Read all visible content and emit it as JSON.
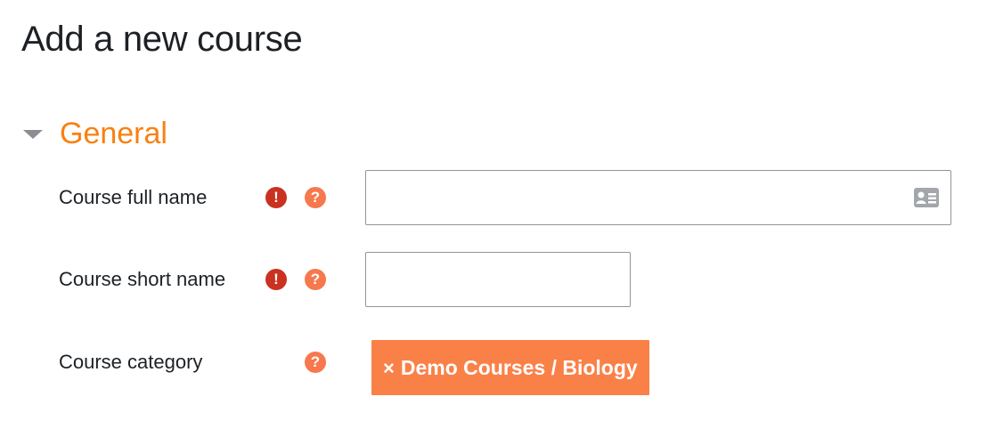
{
  "page": {
    "title": "Add a new course"
  },
  "section": {
    "title": "General",
    "expanded": true
  },
  "fields": [
    {
      "label": "Course full name",
      "required": true,
      "required_glyph": "!",
      "help_glyph": "?",
      "value": "",
      "icon": "contact-card-icon"
    },
    {
      "label": "Course short name",
      "required": true,
      "required_glyph": "!",
      "help_glyph": "?",
      "value": ""
    },
    {
      "label": "Course category",
      "required": false,
      "help_glyph": "?",
      "selected": {
        "remove_glyph": "×",
        "text": "Demo Courses / Biology"
      }
    }
  ],
  "colors": {
    "accent": "#f98012",
    "required": "#ca3120",
    "help": "#f7784d",
    "badge": "#f98148",
    "text": "#1d2125",
    "input_border": "#8f959e"
  }
}
